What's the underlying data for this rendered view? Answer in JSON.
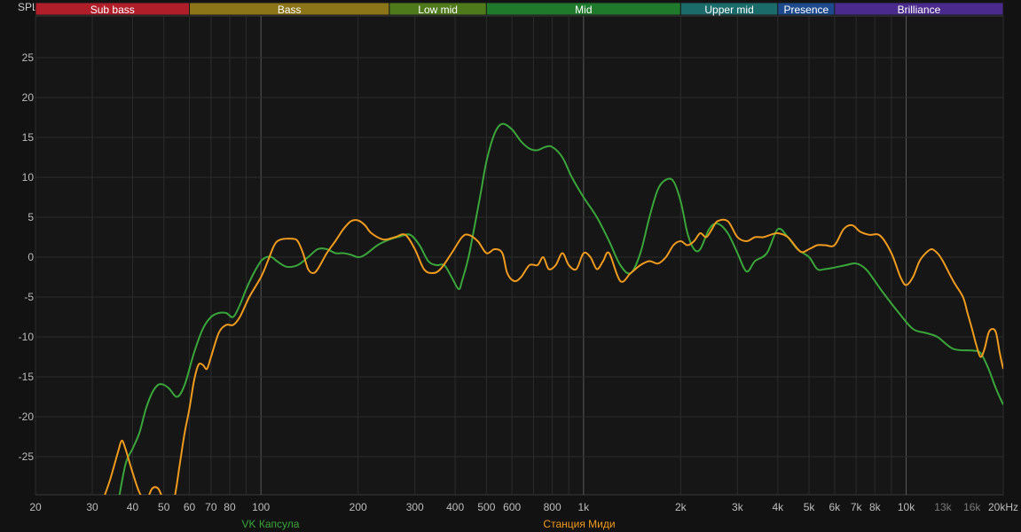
{
  "chart_data": {
    "type": "line",
    "ylabel": "SPL",
    "ylim": [
      -30,
      30
    ],
    "xlim": [
      20,
      20000
    ],
    "x_scale": "log",
    "grid": true,
    "y_ticks": [
      25,
      20,
      15,
      10,
      5,
      0,
      -5,
      -10,
      -15,
      -20,
      -25
    ],
    "x_ticks": [
      {
        "v": 20,
        "label": "20"
      },
      {
        "v": 30,
        "label": "30"
      },
      {
        "v": 40,
        "label": "40"
      },
      {
        "v": 50,
        "label": "50"
      },
      {
        "v": 60,
        "label": "60"
      },
      {
        "v": 70,
        "label": "70"
      },
      {
        "v": 80,
        "label": "80"
      },
      {
        "v": 100,
        "label": "100"
      },
      {
        "v": 200,
        "label": "200"
      },
      {
        "v": 300,
        "label": "300"
      },
      {
        "v": 400,
        "label": "400"
      },
      {
        "v": 500,
        "label": "500"
      },
      {
        "v": 600,
        "label": "600"
      },
      {
        "v": 800,
        "label": "800"
      },
      {
        "v": 1000,
        "label": "1k"
      },
      {
        "v": 2000,
        "label": "2k"
      },
      {
        "v": 3000,
        "label": "3k"
      },
      {
        "v": 4000,
        "label": "4k"
      },
      {
        "v": 5000,
        "label": "5k"
      },
      {
        "v": 6000,
        "label": "6k"
      },
      {
        "v": 7000,
        "label": "7k"
      },
      {
        "v": 8000,
        "label": "8k"
      },
      {
        "v": 10000,
        "label": "10k"
      },
      {
        "v": 13000,
        "label": "13k",
        "dim": true
      },
      {
        "v": 16000,
        "label": "16k",
        "dim": true
      },
      {
        "v": 20000,
        "label": "20kHz"
      }
    ],
    "bands": [
      {
        "name": "Sub bass",
        "from": 20,
        "to": 60,
        "color": "#b01e2a"
      },
      {
        "name": "Bass",
        "from": 60,
        "to": 250,
        "color": "#8c7418"
      },
      {
        "name": "Low mid",
        "from": 250,
        "to": 500,
        "color": "#4f7a1c"
      },
      {
        "name": "Mid",
        "from": 500,
        "to": 2000,
        "color": "#1f7a2c"
      },
      {
        "name": "Upper mid",
        "from": 2000,
        "to": 4000,
        "color": "#1c6b6b"
      },
      {
        "name": "Presence",
        "from": 4000,
        "to": 6000,
        "color": "#1c4a8c"
      },
      {
        "name": "Brilliance",
        "from": 6000,
        "to": 20000,
        "color": "#4a2a8c"
      }
    ],
    "series": [
      {
        "name": "VK Капсула",
        "color": "#3aa63a",
        "points": [
          [
            36,
            -31
          ],
          [
            38,
            -26
          ],
          [
            40,
            -24
          ],
          [
            42,
            -22
          ],
          [
            44,
            -19
          ],
          [
            46,
            -17
          ],
          [
            48,
            -16
          ],
          [
            50,
            -16
          ],
          [
            52,
            -16.5
          ],
          [
            55,
            -17.5
          ],
          [
            58,
            -16
          ],
          [
            62,
            -12
          ],
          [
            66,
            -9
          ],
          [
            70,
            -7.5
          ],
          [
            74,
            -7
          ],
          [
            78,
            -7
          ],
          [
            82,
            -7.5
          ],
          [
            86,
            -6
          ],
          [
            90,
            -4
          ],
          [
            95,
            -2
          ],
          [
            100,
            -0.5
          ],
          [
            104,
            0
          ],
          [
            108,
            0
          ],
          [
            112,
            -0.5
          ],
          [
            120,
            -1.2
          ],
          [
            130,
            -1
          ],
          [
            140,
            0
          ],
          [
            150,
            1
          ],
          [
            160,
            1
          ],
          [
            170,
            0.5
          ],
          [
            180,
            0.5
          ],
          [
            190,
            0.3
          ],
          [
            200,
            0
          ],
          [
            210,
            0.3
          ],
          [
            230,
            1.5
          ],
          [
            250,
            2.2
          ],
          [
            270,
            2.6
          ],
          [
            290,
            2.8
          ],
          [
            310,
            1.5
          ],
          [
            330,
            -0.5
          ],
          [
            350,
            -1
          ],
          [
            370,
            -1
          ],
          [
            390,
            -2.5
          ],
          [
            410,
            -4
          ],
          [
            420,
            -3
          ],
          [
            440,
            0
          ],
          [
            460,
            4
          ],
          [
            480,
            8
          ],
          [
            500,
            12
          ],
          [
            530,
            15.5
          ],
          [
            560,
            16.7
          ],
          [
            600,
            16
          ],
          [
            640,
            14.5
          ],
          [
            680,
            13.6
          ],
          [
            720,
            13.4
          ],
          [
            760,
            13.8
          ],
          [
            800,
            13.8
          ],
          [
            860,
            12.5
          ],
          [
            920,
            10
          ],
          [
            1000,
            7.5
          ],
          [
            1100,
            5
          ],
          [
            1200,
            2
          ],
          [
            1300,
            -1
          ],
          [
            1400,
            -2
          ],
          [
            1500,
            0.5
          ],
          [
            1600,
            5
          ],
          [
            1700,
            8.5
          ],
          [
            1800,
            9.7
          ],
          [
            1900,
            9.5
          ],
          [
            2000,
            7
          ],
          [
            2100,
            3
          ],
          [
            2200,
            1
          ],
          [
            2300,
            1
          ],
          [
            2450,
            3.5
          ],
          [
            2600,
            4.2
          ],
          [
            2800,
            3
          ],
          [
            3000,
            0.5
          ],
          [
            3200,
            -1.8
          ],
          [
            3400,
            -0.5
          ],
          [
            3700,
            0.5
          ],
          [
            4000,
            3.5
          ],
          [
            4300,
            2.5
          ],
          [
            4600,
            1
          ],
          [
            5000,
            0
          ],
          [
            5300,
            -1.5
          ],
          [
            5600,
            -1.5
          ],
          [
            6000,
            -1.3
          ],
          [
            6500,
            -1
          ],
          [
            7000,
            -0.8
          ],
          [
            7500,
            -1.5
          ],
          [
            8000,
            -3
          ],
          [
            8500,
            -4.5
          ],
          [
            9500,
            -7
          ],
          [
            10500,
            -9
          ],
          [
            11500,
            -9.5
          ],
          [
            12500,
            -10
          ],
          [
            14000,
            -11.5
          ],
          [
            16000,
            -11.7
          ],
          [
            17000,
            -12
          ],
          [
            18000,
            -14
          ],
          [
            19000,
            -16.5
          ],
          [
            20000,
            -18.5
          ]
        ]
      },
      {
        "name": "Станция Миди",
        "color": "#f09a1e",
        "points": [
          [
            32,
            -31
          ],
          [
            34,
            -28
          ],
          [
            36,
            -24.5
          ],
          [
            37,
            -23
          ],
          [
            38,
            -24
          ],
          [
            40,
            -27
          ],
          [
            42,
            -29.5
          ],
          [
            44,
            -30.5
          ],
          [
            46,
            -29
          ],
          [
            48,
            -29
          ],
          [
            50,
            -30.5
          ],
          [
            52,
            -31
          ],
          [
            54,
            -30
          ],
          [
            56,
            -26
          ],
          [
            58,
            -22
          ],
          [
            60,
            -19
          ],
          [
            62,
            -15.5
          ],
          [
            64,
            -13.5
          ],
          [
            66,
            -13.5
          ],
          [
            68,
            -14
          ],
          [
            70,
            -12.5
          ],
          [
            74,
            -9.5
          ],
          [
            78,
            -8.5
          ],
          [
            82,
            -8.5
          ],
          [
            86,
            -7.5
          ],
          [
            92,
            -5
          ],
          [
            100,
            -2.5
          ],
          [
            105,
            -0.5
          ],
          [
            110,
            1.5
          ],
          [
            115,
            2.2
          ],
          [
            125,
            2.3
          ],
          [
            130,
            2
          ],
          [
            135,
            0.5
          ],
          [
            140,
            -1.5
          ],
          [
            145,
            -2
          ],
          [
            150,
            -1.5
          ],
          [
            160,
            0.5
          ],
          [
            170,
            2
          ],
          [
            180,
            3.5
          ],
          [
            190,
            4.5
          ],
          [
            200,
            4.6
          ],
          [
            210,
            4
          ],
          [
            220,
            3
          ],
          [
            240,
            2.2
          ],
          [
            260,
            2.5
          ],
          [
            280,
            2.8
          ],
          [
            300,
            1
          ],
          [
            320,
            -1.5
          ],
          [
            340,
            -2
          ],
          [
            360,
            -1.5
          ],
          [
            390,
            0.5
          ],
          [
            420,
            2.5
          ],
          [
            440,
            2.8
          ],
          [
            470,
            2
          ],
          [
            500,
            0.5
          ],
          [
            530,
            1
          ],
          [
            560,
            0.5
          ],
          [
            580,
            -2
          ],
          [
            610,
            -3
          ],
          [
            640,
            -2.5
          ],
          [
            680,
            -1
          ],
          [
            720,
            -1
          ],
          [
            750,
            0
          ],
          [
            780,
            -1.5
          ],
          [
            820,
            -1
          ],
          [
            860,
            0.5
          ],
          [
            900,
            -1
          ],
          [
            950,
            -1.5
          ],
          [
            1000,
            0.5
          ],
          [
            1050,
            0
          ],
          [
            1100,
            -1.5
          ],
          [
            1150,
            -0.5
          ],
          [
            1200,
            0.5
          ],
          [
            1300,
            -3
          ],
          [
            1400,
            -2
          ],
          [
            1500,
            -1
          ],
          [
            1600,
            -0.5
          ],
          [
            1700,
            -0.8
          ],
          [
            1800,
            0
          ],
          [
            1900,
            1.5
          ],
          [
            2000,
            2
          ],
          [
            2100,
            1.5
          ],
          [
            2200,
            2
          ],
          [
            2300,
            3
          ],
          [
            2400,
            2.5
          ],
          [
            2500,
            3.5
          ],
          [
            2600,
            4.5
          ],
          [
            2800,
            4.5
          ],
          [
            3000,
            2.5
          ],
          [
            3200,
            2
          ],
          [
            3400,
            2.5
          ],
          [
            3600,
            2.5
          ],
          [
            3800,
            2.8
          ],
          [
            4000,
            3
          ],
          [
            4300,
            2.5
          ],
          [
            4700,
            0.7
          ],
          [
            5000,
            1
          ],
          [
            5300,
            1.5
          ],
          [
            5600,
            1.5
          ],
          [
            6000,
            1.5
          ],
          [
            6400,
            3.5
          ],
          [
            6800,
            4
          ],
          [
            7200,
            3.2
          ],
          [
            7700,
            2.8
          ],
          [
            8300,
            2.7
          ],
          [
            9000,
            0.5
          ],
          [
            9600,
            -2.5
          ],
          [
            10000,
            -3.5
          ],
          [
            10500,
            -2.5
          ],
          [
            11000,
            -0.5
          ],
          [
            11500,
            0.5
          ],
          [
            12000,
            1
          ],
          [
            12500,
            0.5
          ],
          [
            13000,
            -0.5
          ],
          [
            14000,
            -3
          ],
          [
            15000,
            -5
          ],
          [
            15500,
            -7
          ],
          [
            16000,
            -9
          ],
          [
            16500,
            -11
          ],
          [
            17000,
            -12.5
          ],
          [
            17500,
            -11.5
          ],
          [
            18000,
            -9.5
          ],
          [
            18500,
            -9
          ],
          [
            19000,
            -9.5
          ],
          [
            19500,
            -12
          ],
          [
            20000,
            -14
          ]
        ]
      }
    ]
  }
}
